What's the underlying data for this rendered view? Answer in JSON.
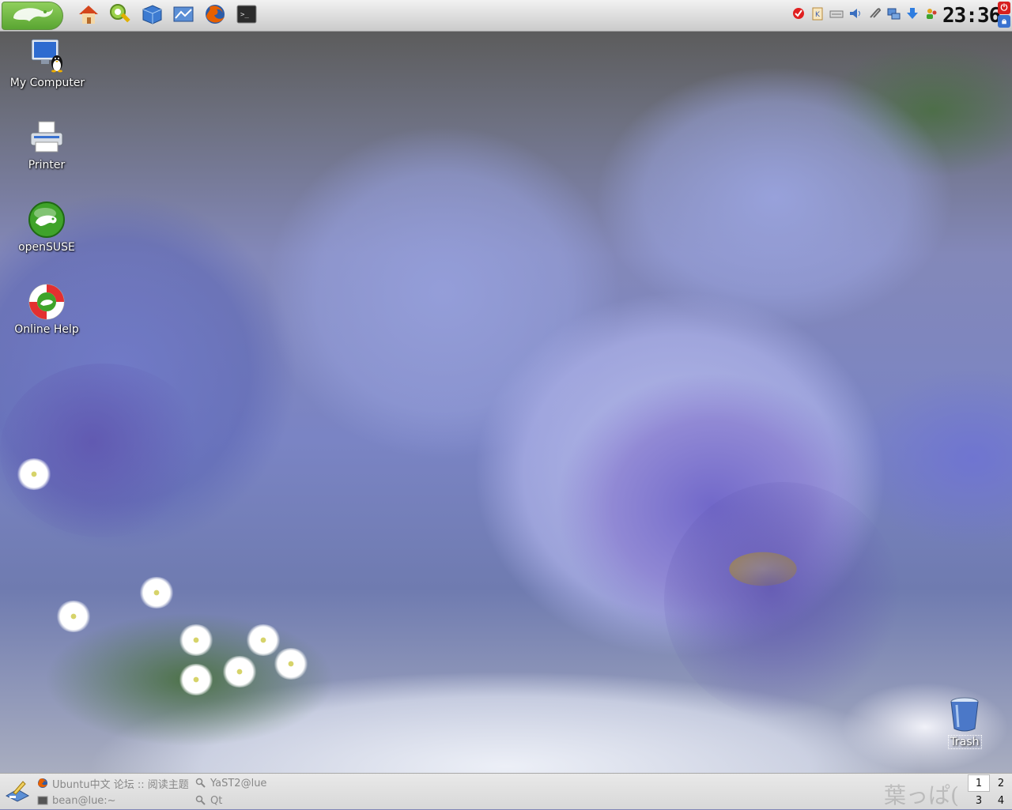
{
  "top_panel": {
    "start_icon": "opensuse-gecko-icon",
    "launchers": [
      {
        "name": "home-folder-icon"
      },
      {
        "name": "control-center-icon"
      },
      {
        "name": "package-manager-icon"
      },
      {
        "name": "network-browser-icon"
      },
      {
        "name": "firefox-icon"
      },
      {
        "name": "terminal-icon"
      }
    ],
    "tray_icons": [
      "updater-icon",
      "klipper-icon",
      "keyboard-icon",
      "volume-icon",
      "paperclip-icon",
      "network-icon",
      "download-icon",
      "messenger-icon"
    ],
    "clock": "23:36"
  },
  "desktop": {
    "icons": [
      {
        "label": "My Computer"
      },
      {
        "label": "Printer"
      },
      {
        "label": "openSUSE"
      },
      {
        "label": "Online Help"
      }
    ],
    "trash_label": "Trash"
  },
  "bottom_panel": {
    "tasks": [
      {
        "label": "Ubuntu中文 论坛 :: 阅读主题",
        "icon": "firefox-icon"
      },
      {
        "label": "YaST2@lue",
        "icon": "yast-icon"
      },
      {
        "label": "bean@lue:~",
        "icon": "terminal-icon"
      },
      {
        "label": "Qt",
        "icon": "yast-icon"
      }
    ],
    "watermark": "葉っぱ(",
    "desktops": [
      "1",
      "2",
      "3",
      "4"
    ],
    "active_desktop": "1",
    "colors": {
      "panel": "#dcdcdc",
      "task_text": "#888888"
    }
  }
}
